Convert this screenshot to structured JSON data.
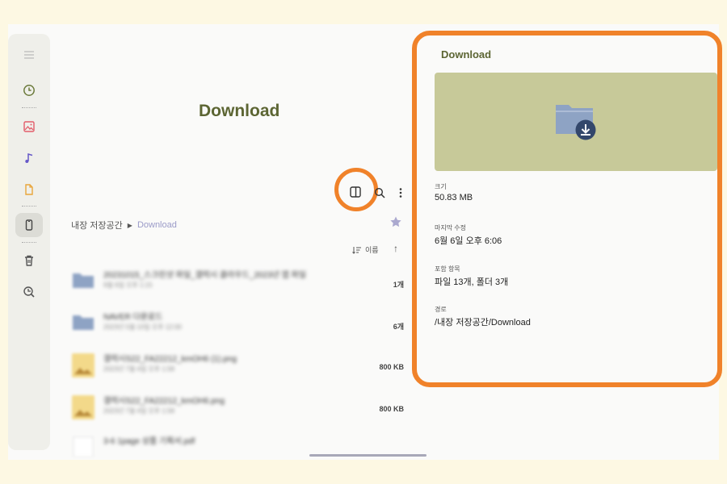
{
  "sidebar": {
    "items": [
      {
        "icon": "menu-icon"
      },
      {
        "icon": "clock-icon"
      },
      {
        "icon": "image-icon"
      },
      {
        "icon": "music-note-icon"
      },
      {
        "icon": "document-icon"
      },
      {
        "icon": "phone-storage-icon",
        "selected": true
      },
      {
        "icon": "trash-icon"
      },
      {
        "icon": "storage-analysis-icon"
      }
    ]
  },
  "main": {
    "title": "Download",
    "breadcrumb": {
      "root": "내장 저장공간",
      "separator": "▶",
      "current": "Download"
    },
    "sort": {
      "label": "이름",
      "direction": "ascending"
    },
    "files": [
      {
        "type": "folder",
        "name": "20231015_스크린샷 파일_갤럭시 클라우드_2023년 앱 파일",
        "sub": "9월 6일 오후 1:15",
        "meta": "1개"
      },
      {
        "type": "folder",
        "name": "NAVER 다운로드",
        "sub": "2023년 5월 10일 오후 12:00",
        "meta": "6개"
      },
      {
        "type": "image",
        "name": "갤럭시S22_FA22212_kmOH6 (1).png",
        "sub": "2023년 7월 4일 오후 1:58",
        "meta": "800 KB"
      },
      {
        "type": "image",
        "name": "갤럭시S22_FA22212_kmOH6.png",
        "sub": "2023년 7월 4일 오후 1:58",
        "meta": "800 KB"
      },
      {
        "type": "pdf",
        "name": "3-6 1page 상품 기획서.pdf",
        "sub": "",
        "meta": ""
      }
    ]
  },
  "details": {
    "title": "Download",
    "fields": [
      {
        "label": "크기",
        "value": "50.83 MB"
      },
      {
        "label": "마지막 수정",
        "value": "6월 6일 오후 6:06"
      },
      {
        "label": "포함 항목",
        "value": "파일 13개, 폴더 3개"
      },
      {
        "label": "경로",
        "value": "/내장 저장공간/Download"
      }
    ]
  },
  "colors": {
    "accent": "#5c6533",
    "highlight": "#f0822a",
    "preview_bg": "#c7c999",
    "folder": "#8ea3c4"
  }
}
